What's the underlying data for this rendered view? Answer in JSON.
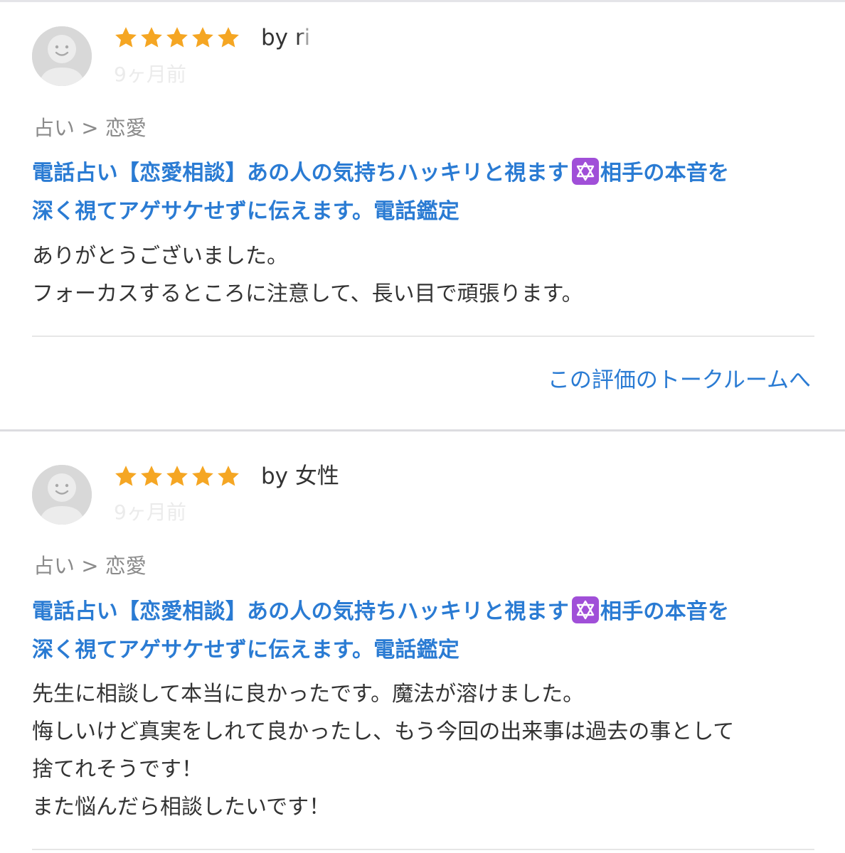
{
  "colors": {
    "accent": "#2a7bd3",
    "star": "#f5a623",
    "badge": "#a04fd8",
    "muted": "#8a8a8a",
    "text": "#333333",
    "avatar_bg": "#d8d8d8"
  },
  "reviews": [
    {
      "rating": 5,
      "author": "by ri",
      "posted": "9ヶ月前",
      "category": "占い > 恋愛",
      "service_title_line1_a": "電話占い【恋愛相談】あの人の気持ちハッキリと視ます",
      "service_title_badge_icon": "six-pointed-star-icon",
      "service_title_line1_b": "相手の本音を",
      "service_title_line2": "深く視てアゲサケせずに伝えます。電話鑑定",
      "body_lines": [
        "ありがとうございました。",
        "フォーカスするところに注意して、長い目で頑張ります。"
      ],
      "talkroom_link": "この評価のトークルームへ"
    },
    {
      "rating": 5,
      "author": "by 女性",
      "posted": "9ヶ月前",
      "category": "占い > 恋愛",
      "service_title_line1_a": "電話占い【恋愛相談】あの人の気持ちハッキリと視ます",
      "service_title_badge_icon": "six-pointed-star-icon",
      "service_title_line1_b": "相手の本音を",
      "service_title_line2": "深く視てアゲサケせずに伝えます。電話鑑定",
      "body_lines": [
        "先生に相談して本当に良かったです。魔法が溶けました。",
        "悔しいけど真実をしれて良かったし、もう今回の出来事は過去の事として",
        "捨てれそうです！",
        "また悩んだら相談したいです！"
      ]
    }
  ]
}
